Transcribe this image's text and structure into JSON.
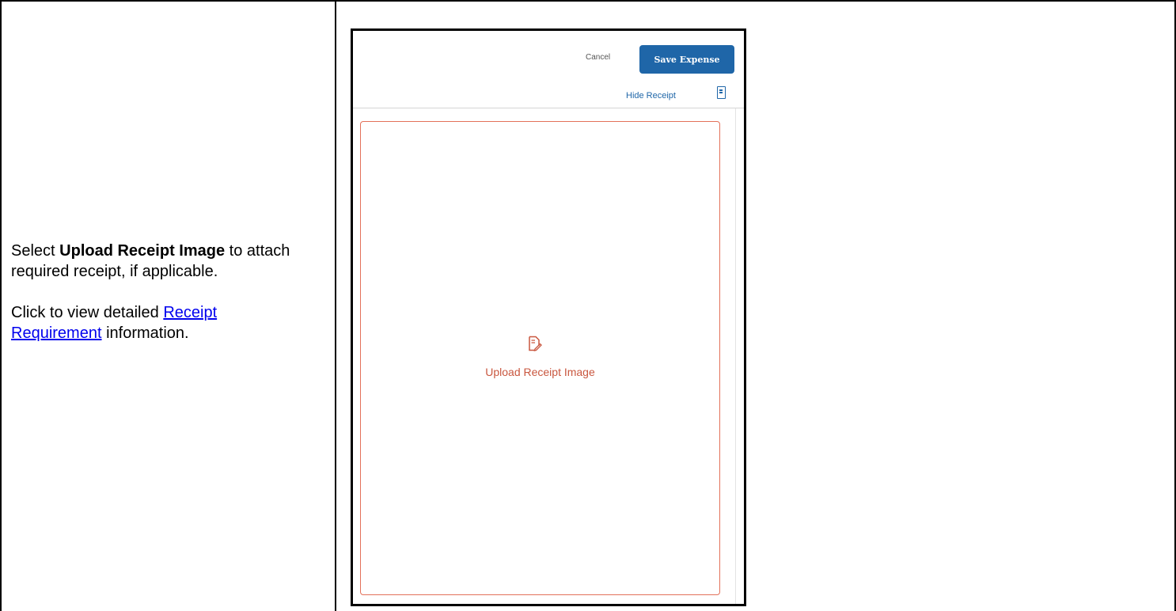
{
  "instructions": {
    "select_prefix": "Select ",
    "select_bold": "Upload Receipt Image",
    "select_suffix": " to attach required receipt, if applicable.",
    "click_prefix": "Click to view detailed ",
    "click_link": "Receipt Requirement",
    "click_suffix": " information."
  },
  "screenshot": {
    "cancel_label": "Cancel",
    "save_label": "Save Expense",
    "hide_receipt_label": "Hide Receipt",
    "hide_receipt_icon": "receipt-doc-icon",
    "upload_icon": "receipt-upload-icon",
    "upload_label": "Upload Receipt Image",
    "colors": {
      "primary": "#1f66a8",
      "upload_accent": "#c9573f",
      "upload_border": "#e3715a"
    }
  }
}
